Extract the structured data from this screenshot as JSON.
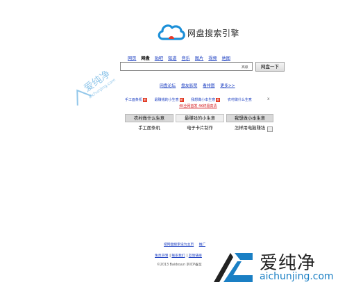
{
  "logo": {
    "title": "网盘搜索引擎"
  },
  "nav": [
    "网页",
    "网盘",
    "贴吧",
    "知道",
    "音乐",
    "图片",
    "视频",
    "地图"
  ],
  "search": {
    "value": "",
    "adv_label": "高级",
    "button": "网盘一下"
  },
  "sublinks": [
    "网盘论坛",
    "盘友影院",
    "看排图",
    "更多>>"
  ],
  "hot": {
    "items": [
      "手工面条机",
      "最赚钱的小生意",
      "我想做小本生意",
      "农村做什么生意"
    ],
    "close": "x",
    "promo": "4K全网首发 4K终极高清"
  },
  "tags_row1": [
    "农村做什么生意",
    "最赚钱的小生意",
    "我想做小本生意"
  ],
  "tags_row2": [
    "手工面条机",
    "电子卡片制作",
    "怎样用电脑赚钱"
  ],
  "footer": {
    "line1": [
      "把网盘搜索设为主页",
      "推广"
    ],
    "line2": [
      "免责声明",
      "联系我们",
      "友情链接"
    ],
    "copyright": "©2013 Baidoyun 京ICP备案"
  },
  "watermark": {
    "text": "爱纯净",
    "url": "aichunjing.com",
    "small_text": "爱纯净",
    "small_url": "aichunjing.com"
  }
}
